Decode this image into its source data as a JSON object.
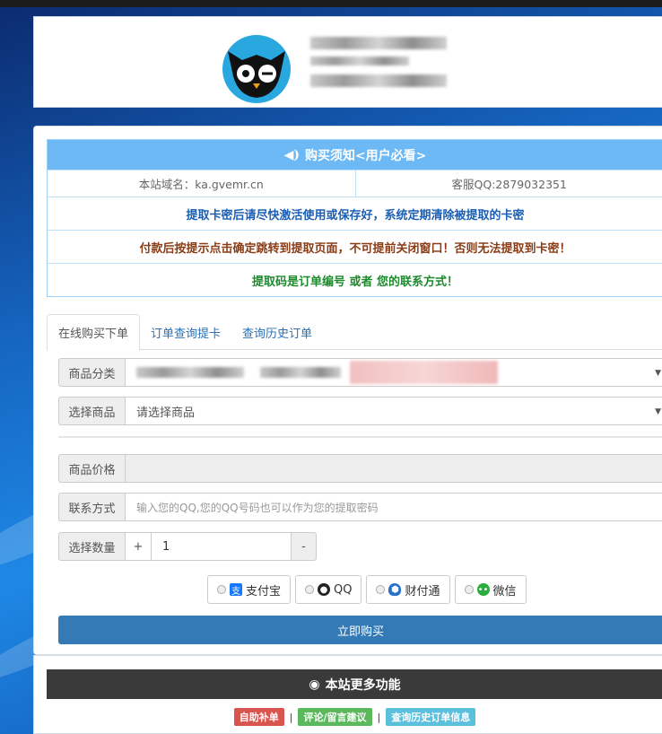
{
  "notice": {
    "title": "购买须知<用户必看>",
    "domain": "本站域名：ka.gvemr.cn",
    "support_qq": "客服QQ:2879032351",
    "line1": "提取卡密后请尽快激活使用或保存好，系统定期清除被提取的卡密",
    "line2": "付款后按提示点击确定跳转到提取页面，不可提前关闭窗口！否则无法提取到卡密！",
    "line3": "提取码是订单编号 或者 您的联系方式！"
  },
  "tabs": [
    "在线购买下单",
    "订单查询提卡",
    "查询历史订单"
  ],
  "form": {
    "category_label": "商品分类",
    "product_label": "选择商品",
    "product_value": "请选择商品",
    "price_label": "商品价格",
    "contact_label": "联系方式",
    "contact_placeholder": "输入您的QQ,您的QQ号码也可以作为您的提取密码",
    "qty_label": "选择数量",
    "qty_plus": "+",
    "qty_value": "1",
    "qty_minus": "-"
  },
  "payment": [
    "支付宝",
    "QQ",
    "财付通",
    "微信"
  ],
  "buy_button": "立即购买",
  "more": {
    "title": "本站更多功能",
    "links": [
      "自助补单",
      "评论/留言建议",
      "查询历史订单信息"
    ],
    "separator": "|"
  },
  "colors": {
    "notice_head": "#6cb9f5",
    "buy_button": "#337ab7",
    "link_red": "#d9534f",
    "link_green": "#5cb85c",
    "link_blue": "#5bc0de"
  }
}
